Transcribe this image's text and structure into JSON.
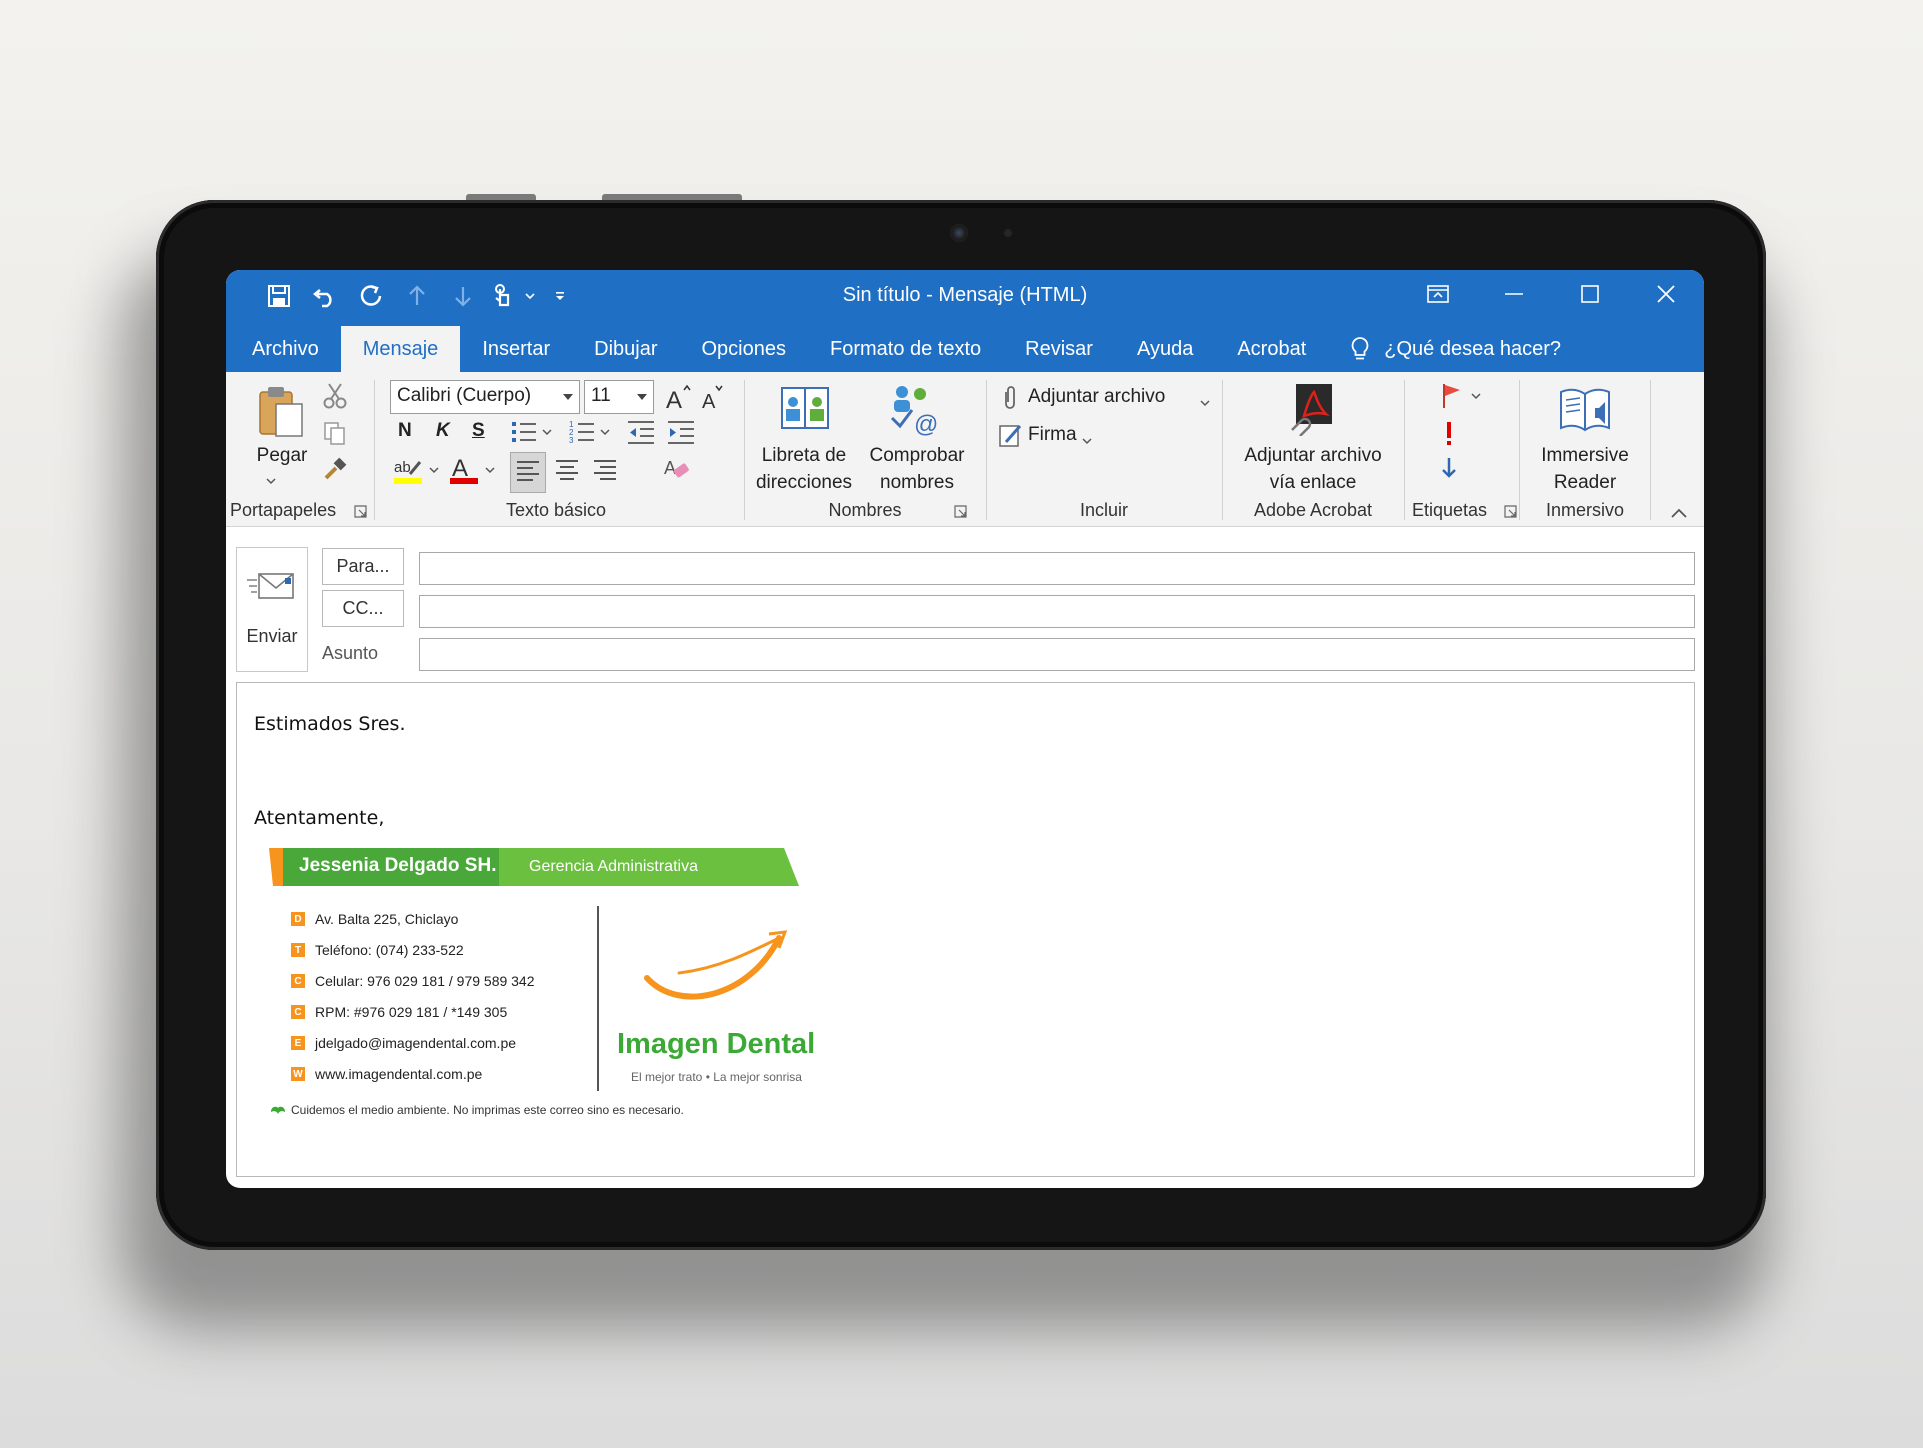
{
  "window": {
    "title": "Sin título  -  Mensaje (HTML)"
  },
  "qat": {
    "icons": [
      "save-icon",
      "undo-icon",
      "redo-icon",
      "up-arrow-icon",
      "down-arrow-icon",
      "touch-mode-icon",
      "customize-icon"
    ]
  },
  "tabs": [
    {
      "label": "Archivo",
      "active": false
    },
    {
      "label": "Mensaje",
      "active": true
    },
    {
      "label": "Insertar",
      "active": false
    },
    {
      "label": "Dibujar",
      "active": false
    },
    {
      "label": "Opciones",
      "active": false
    },
    {
      "label": "Formato de texto",
      "active": false
    },
    {
      "label": "Revisar",
      "active": false
    },
    {
      "label": "Ayuda",
      "active": false
    },
    {
      "label": "Acrobat",
      "active": false
    }
  ],
  "tellme": {
    "label": "¿Qué desea hacer?"
  },
  "ribbon": {
    "clipboard": {
      "paste": "Pegar",
      "group": "Portapapeles"
    },
    "basic_text": {
      "font": "Calibri (Cuerpo)",
      "size": "11",
      "bold": "N",
      "italic": "K",
      "underline": "S",
      "group": "Texto básico"
    },
    "names": {
      "address_book_1": "Libreta de",
      "address_book_2": "direcciones",
      "check_names_1": "Comprobar",
      "check_names_2": "nombres",
      "group": "Nombres"
    },
    "include": {
      "attach_file": "Adjuntar archivo",
      "signature": "Firma",
      "group": "Incluir"
    },
    "acrobat": {
      "attach_link_1": "Adjuntar archivo",
      "attach_link_2": "vía enlace",
      "group": "Adobe Acrobat"
    },
    "tags": {
      "group": "Etiquetas"
    },
    "immersive": {
      "reader_1": "Immersive",
      "reader_2": "Reader",
      "group": "Inmersivo"
    }
  },
  "compose": {
    "send": "Enviar",
    "to_button": "Para...",
    "cc_button": "CC...",
    "subject_label": "Asunto",
    "to_value": "",
    "cc_value": "",
    "subject_value": ""
  },
  "body": {
    "greeting": "Estimados Sres.",
    "closing": "Atentamente,"
  },
  "signature": {
    "name": "Jessenia Delgado SH.",
    "role": "Gerencia Administrativa",
    "lines": [
      {
        "letter": "D",
        "text": "Av. Balta 225, Chiclayo"
      },
      {
        "letter": "T",
        "text": "Teléfono: (074) 233-522"
      },
      {
        "letter": "C",
        "text": "Celular: 976 029 181  /  979 589 342"
      },
      {
        "letter": "C",
        "text": "RPM: #976 029 181 / *149 305"
      },
      {
        "letter": "E",
        "text": "jdelgado@imagendental.com.pe"
      },
      {
        "letter": "W",
        "text": "www.imagendental.com.pe"
      }
    ],
    "brand": "Imagen Dental",
    "slogan": "El mejor trato • La mejor sonrisa",
    "eco_note": "Cuidemos el medio ambiente. No imprimas este correo sino es necesario.",
    "colors": {
      "green": "#5cb82e",
      "orange": "#f7941d"
    }
  },
  "colors": {
    "accent": "#1f6fc4",
    "ribbon_bg": "#f3f3f3"
  }
}
